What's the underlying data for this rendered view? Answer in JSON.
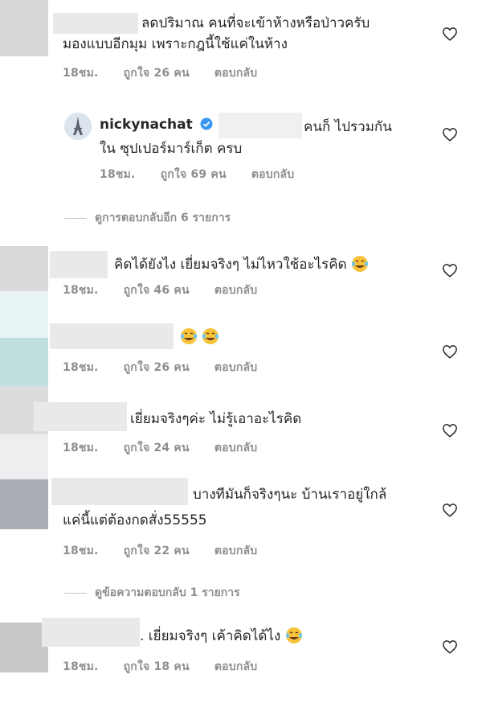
{
  "icons": {
    "heart": "heart-outline-icon",
    "verified": "verified-badge-icon",
    "emoji": "face-with-tears-of-joy-icon"
  },
  "colors": {
    "meta": "#8e8e8e",
    "text": "#262626",
    "verified": "#3897f0"
  },
  "comments": [
    {
      "line1": "ลดปริมาณ คนที่จะเข้าห้างหรือป่าวครับ",
      "line2": "มองแบบอีกมุม เพราะกฎนี้ใช้แค่ในห้าง",
      "time": "18ชม.",
      "likes": "ถูกใจ 26 คน",
      "reply": "ตอบกลับ"
    },
    {
      "username": "nickynachat",
      "line1": "คนก็ ไปรวมกัน",
      "line2": "ใน ซุปเปอร์มาร์เก็ต ครบ",
      "time": "18ชม.",
      "likes": "ถูกใจ 69 คน",
      "reply": "ตอบกลับ"
    },
    {
      "line1": "คิดได้ยังไง เยี่ยมจริงๆ ไม่ไหวใช้อะไรคิด",
      "time": "18ชม.",
      "likes": "ถูกใจ 46 คน",
      "reply": "ตอบกลับ"
    },
    {
      "line1": "",
      "time": "18ชม.",
      "likes": "ถูกใจ 26 คน",
      "reply": "ตอบกลับ"
    },
    {
      "line1": "เยี่ยมจริงๆค่ะ ไม่รู้เอาอะไรคิด",
      "time": "18ชม.",
      "likes": "ถูกใจ 24 คน",
      "reply": "ตอบกลับ"
    },
    {
      "line1": "บางทีมันก็จริงๆนะ บ้านเราอยู่ใกล้",
      "line2": "แค่นี้แต่ต้องกดสั่ง55555",
      "time": "18ชม.",
      "likes": "ถูกใจ 22 คน",
      "reply": "ตอบกลับ"
    },
    {
      "line1": ". เยี่ยมจริงๆ เค้าคิดได้ไง",
      "time": "18ชม.",
      "likes": "ถูกใจ 18 คน",
      "reply": "ตอบกลับ"
    }
  ],
  "view_more": [
    {
      "label": "ดูการตอบกลับอีก 6 รายการ"
    },
    {
      "label": "ดูข้อความตอบกลับ 1 รายการ"
    }
  ]
}
